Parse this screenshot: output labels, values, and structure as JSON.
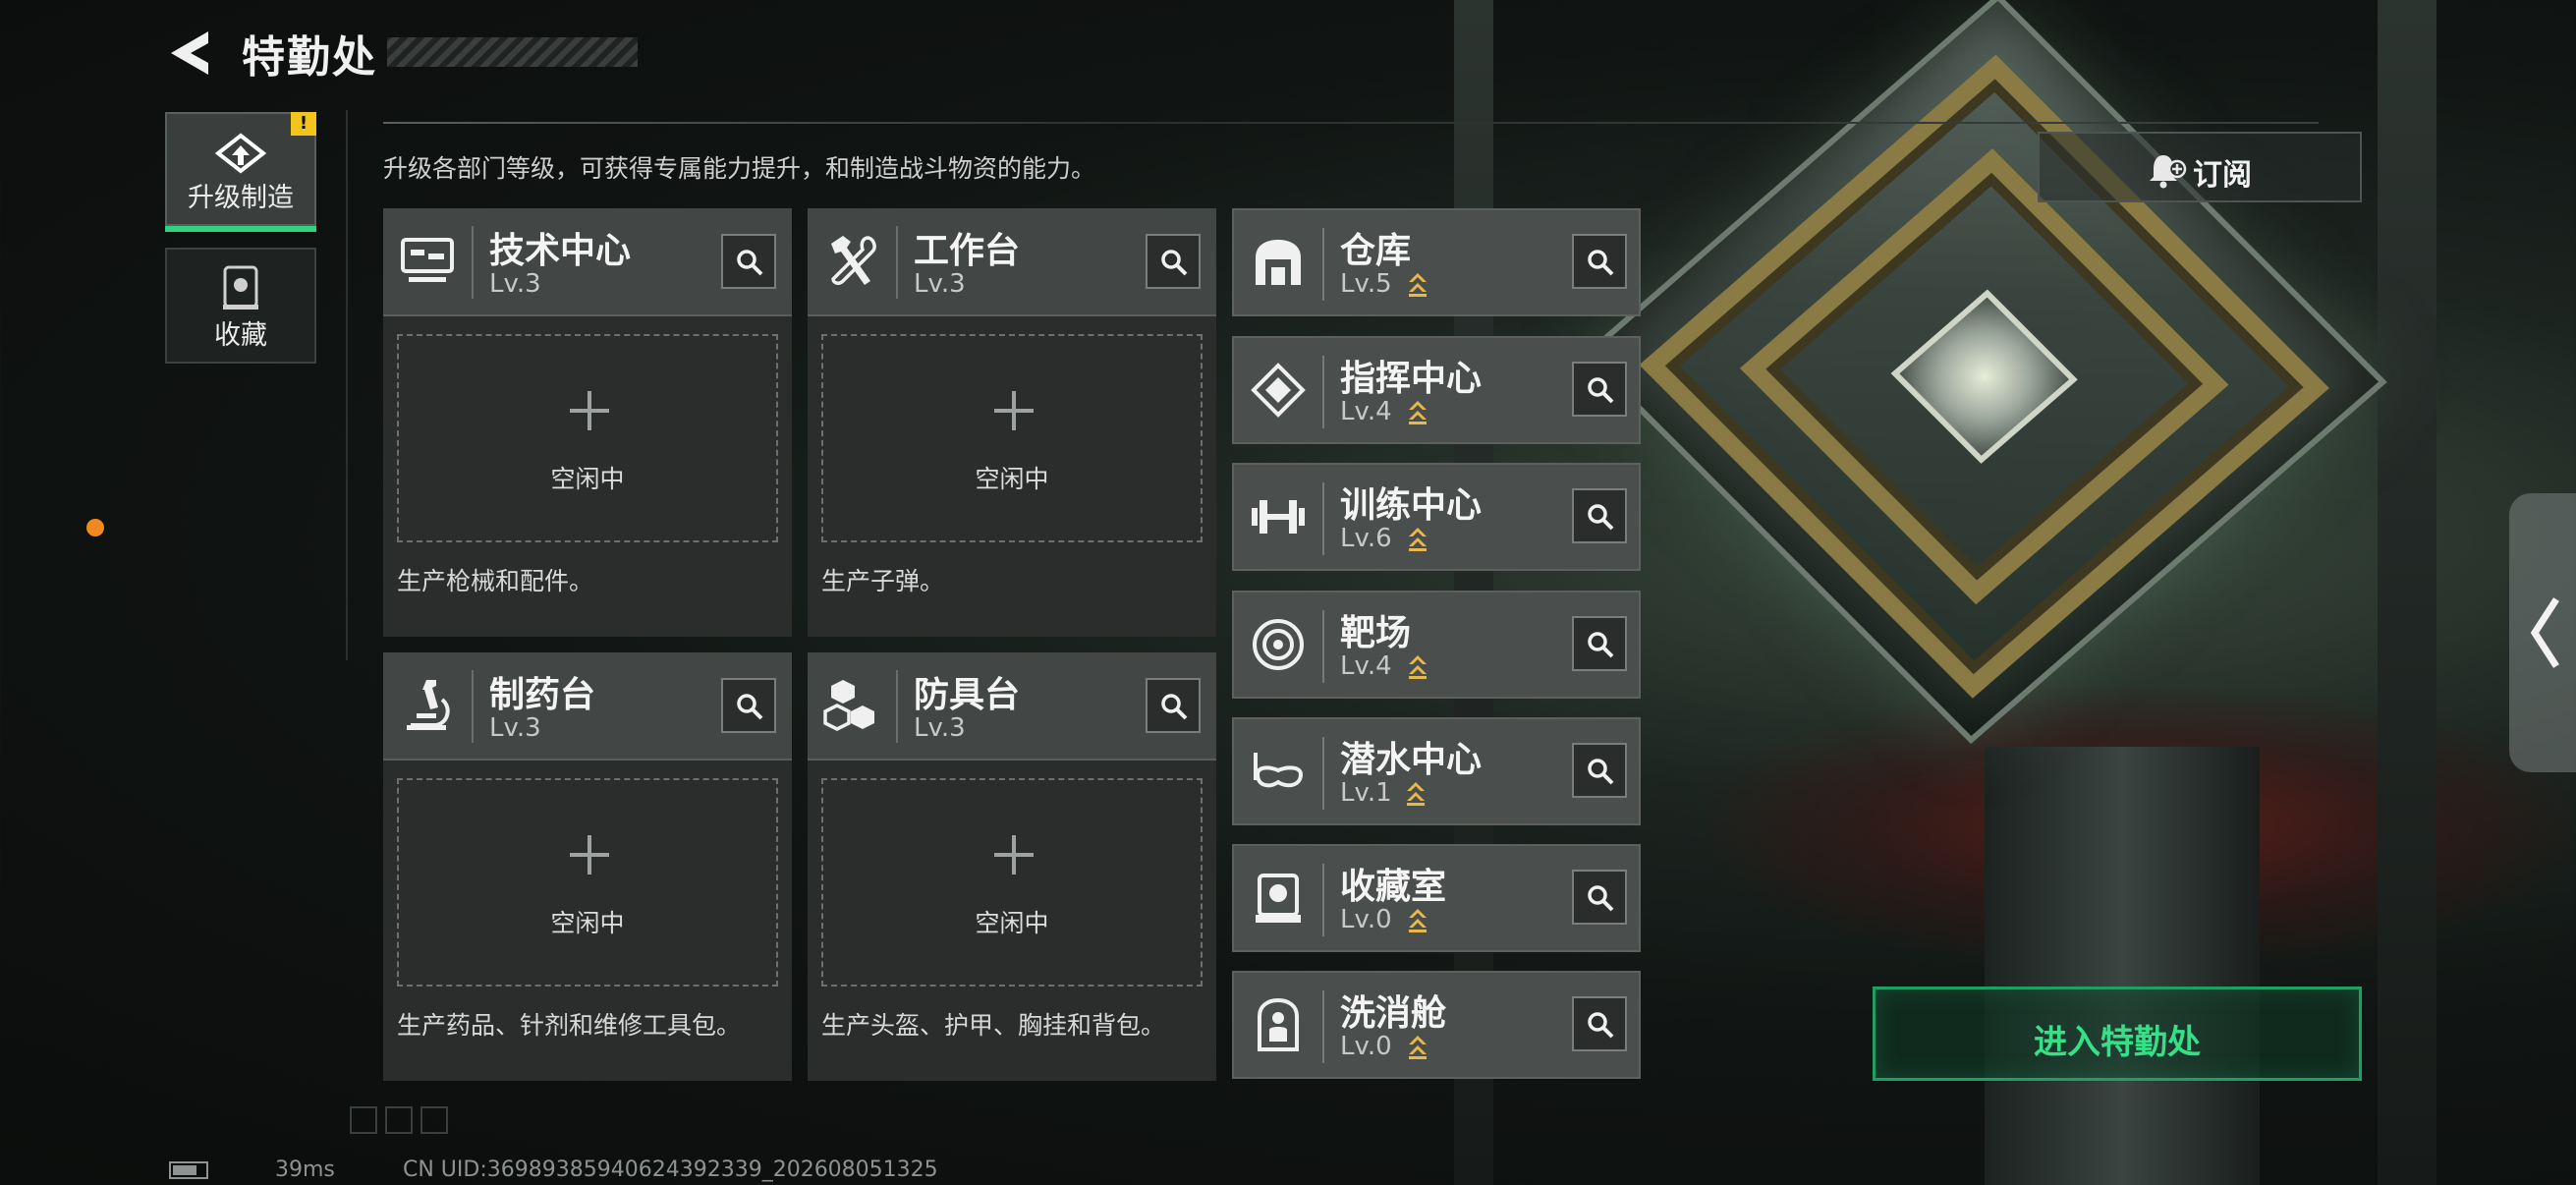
{
  "header": {
    "title": "特勤处",
    "subtitle": "升级各部门等级，可获得专属能力提升，和制造战斗物资的能力。"
  },
  "tabs": [
    {
      "label": "升级制造",
      "badge": "!"
    },
    {
      "label": "收藏"
    }
  ],
  "subscribe_label": "订阅",
  "production": [
    {
      "name": "技术中心",
      "level": "Lv.3",
      "slot": "空闲中",
      "desc": "生产枪械和配件。",
      "icon": "monitor-icon"
    },
    {
      "name": "工作台",
      "level": "Lv.3",
      "slot": "空闲中",
      "desc": "生产子弹。",
      "icon": "hammer-wrench-icon"
    },
    {
      "name": "制药台",
      "level": "Lv.3",
      "slot": "空闲中",
      "desc": "生产药品、针剂和维修工具包。",
      "icon": "microscope-icon"
    },
    {
      "name": "防具台",
      "level": "Lv.3",
      "slot": "空闲中",
      "desc": "生产头盔、护甲、胸挂和背包。",
      "icon": "cubes-icon"
    }
  ],
  "facilities": [
    {
      "name": "仓库",
      "level": "Lv.5",
      "icon": "warehouse-icon"
    },
    {
      "name": "指挥中心",
      "level": "Lv.4",
      "icon": "chip-icon"
    },
    {
      "name": "训练中心",
      "level": "Lv.6",
      "icon": "dumbbell-icon"
    },
    {
      "name": "靶场",
      "level": "Lv.4",
      "icon": "target-icon"
    },
    {
      "name": "潜水中心",
      "level": "Lv.1",
      "icon": "diving-mask-icon"
    },
    {
      "name": "收藏室",
      "level": "Lv.0",
      "icon": "display-case-icon"
    },
    {
      "name": "洗消舱",
      "level": "Lv.0",
      "icon": "decon-pod-icon"
    }
  ],
  "enter_label": "进入特勤处",
  "status": {
    "ping": "39ms",
    "uid": "CN UID:3698938594062439233​9_202608051325"
  },
  "colors": {
    "accent": "#2fd27e",
    "upgrade_arrow": "#e8b84a",
    "badge": "#f2c51d",
    "dot": "#f08a20"
  }
}
